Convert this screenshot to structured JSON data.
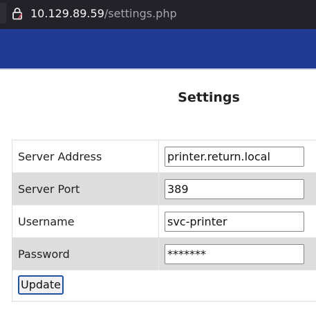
{
  "browser": {
    "url_host": "10.129.89.59",
    "url_path": "/settings.php",
    "lock_icon": "insecure-lock-icon"
  },
  "navbar": {
    "color": "#1f3a93"
  },
  "page": {
    "title": "Settings"
  },
  "form": {
    "rows": [
      {
        "label": "Server Address",
        "value": "printer.return.local"
      },
      {
        "label": "Server Port",
        "value": "389"
      },
      {
        "label": "Username",
        "value": "svc-printer"
      },
      {
        "label": "Password",
        "value": "*******"
      }
    ],
    "update_label": "Update"
  }
}
